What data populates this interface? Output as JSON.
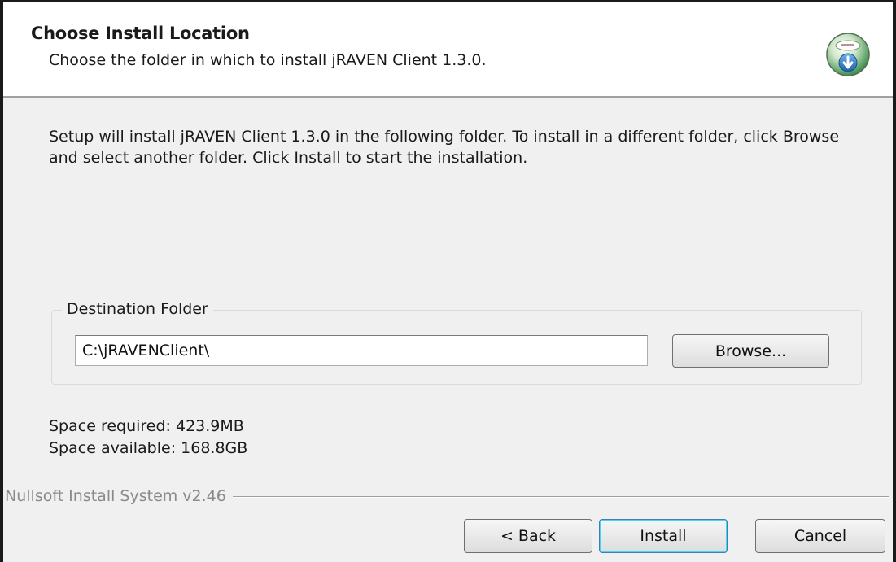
{
  "header": {
    "title": "Choose Install Location",
    "subtitle": "Choose the folder in which to install jRAVEN Client 1.3.0."
  },
  "description": "Setup will install jRAVEN Client 1.3.0 in the following folder. To install in a different folder, click Browse and select another folder. Click Install to start the installation.",
  "destination": {
    "legend": "Destination Folder",
    "path": "C:\\jRAVENClient\\",
    "browse_label": "Browse..."
  },
  "space": {
    "required": "Space required: 423.9MB",
    "available": "Space available: 168.8GB"
  },
  "branding": "Nullsoft Install System v2.46",
  "buttons": {
    "back": "< Back",
    "install": "Install",
    "cancel": "Cancel"
  },
  "icons": {
    "logo": "installer-disc-icon"
  },
  "colors": {
    "header_bg": "#ffffff",
    "dialog_bg": "#f0f0f0",
    "default_button_border": "#3c7fb1"
  }
}
